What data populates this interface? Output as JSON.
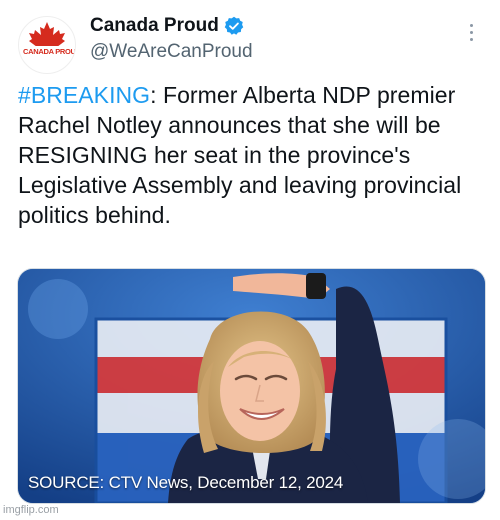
{
  "account": {
    "display_name": "Canada Proud",
    "handle": "@WeAreCanProud",
    "avatar_text": "CANADA PROUD",
    "verified_icon": "verified-badge-icon",
    "more_icon": "more-options-icon",
    "avatar_icon": "maple-leaf-icon"
  },
  "tweet": {
    "hashtag": "#BREAKING",
    "body": ": Former Alberta NDP premier Rachel Notley announces that she will be RESIGNING her seat in the province's Legislative Assembly and leaving provincial politics behind."
  },
  "media": {
    "caption": "SOURCE: CTV News, December 12, 2024"
  },
  "watermark": "imgflip.com",
  "colors": {
    "accent": "#1d9bf0",
    "text": "#0f1419",
    "secondary_text": "#536471",
    "brand_red": "#d52b1e"
  }
}
